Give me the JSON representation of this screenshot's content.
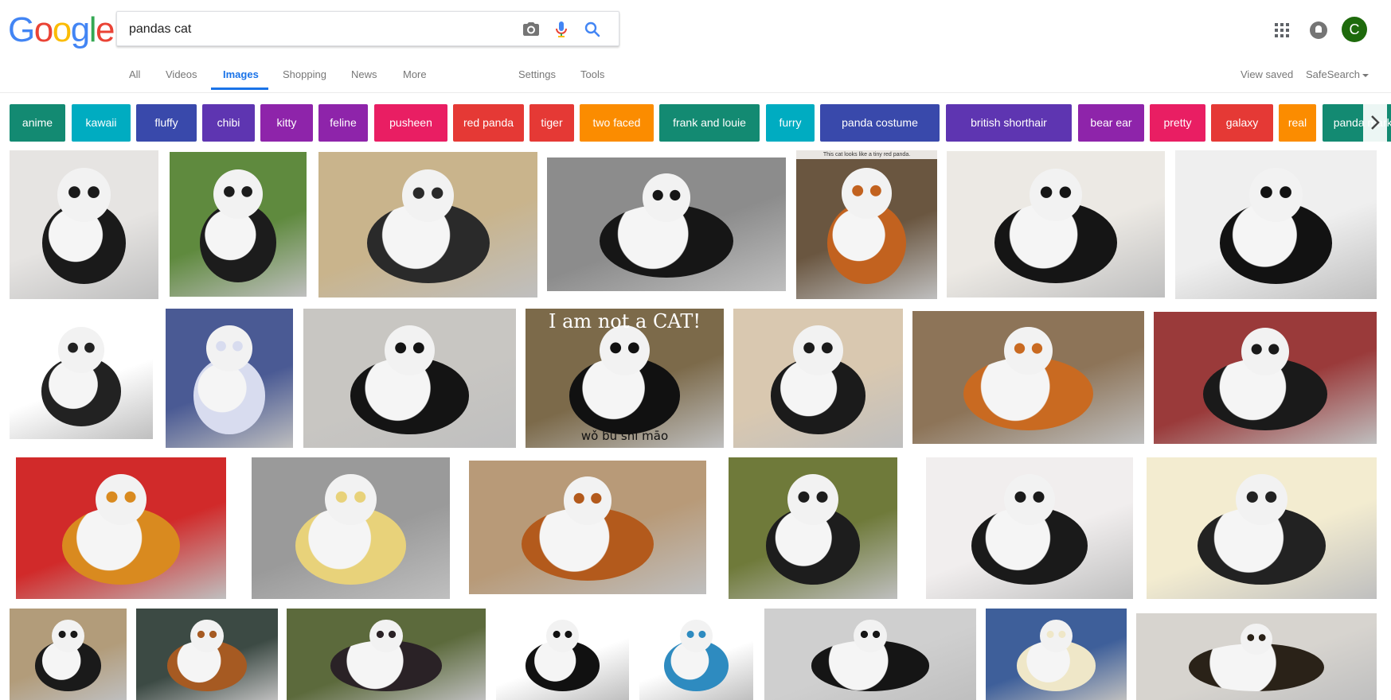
{
  "logo": {
    "letters": [
      {
        "ch": "G",
        "color": "#4285F4"
      },
      {
        "ch": "o",
        "color": "#EA4335"
      },
      {
        "ch": "o",
        "color": "#FBBC05"
      },
      {
        "ch": "g",
        "color": "#4285F4"
      },
      {
        "ch": "l",
        "color": "#34A853"
      },
      {
        "ch": "e",
        "color": "#EA4335"
      }
    ]
  },
  "search": {
    "value": "pandas cat",
    "icons": [
      "camera-icon",
      "microphone-icon",
      "search-icon"
    ]
  },
  "header": {
    "avatar_letter": "C",
    "icons": [
      "apps-grid-icon",
      "notifications-icon"
    ]
  },
  "nav": {
    "tabs": [
      {
        "label": "All",
        "active": false
      },
      {
        "label": "Videos",
        "active": false
      },
      {
        "label": "Images",
        "active": true
      },
      {
        "label": "Shopping",
        "active": false
      },
      {
        "label": "News",
        "active": false
      },
      {
        "label": "More",
        "active": false
      }
    ],
    "settings": "Settings",
    "tools": "Tools",
    "view_saved": "View saved",
    "safesearch": "SafeSearch"
  },
  "chips": [
    {
      "label": "anime",
      "color": "#138a72"
    },
    {
      "label": "kawaii",
      "color": "#00acc1"
    },
    {
      "label": "fluffy",
      "color": "#3949ab"
    },
    {
      "label": "chibi",
      "color": "#5e35b1"
    },
    {
      "label": "kitty",
      "color": "#8e24aa"
    },
    {
      "label": "feline",
      "color": "#8e24aa"
    },
    {
      "label": "pusheen",
      "color": "#e91e63"
    },
    {
      "label": "red panda",
      "color": "#e53935"
    },
    {
      "label": "tiger",
      "color": "#e53935"
    },
    {
      "label": "two faced",
      "color": "#fb8c00"
    },
    {
      "label": "frank and louie",
      "color": "#138a72"
    },
    {
      "label": "furry",
      "color": "#00acc1"
    },
    {
      "label": "panda costume",
      "color": "#3949ab"
    },
    {
      "label": "british shorthair",
      "color": "#5e35b1"
    },
    {
      "label": "bear ear",
      "color": "#8e24aa"
    },
    {
      "label": "pretty",
      "color": "#e91e63"
    },
    {
      "label": "galaxy",
      "color": "#e53935"
    },
    {
      "label": "real",
      "color": "#fb8c00"
    },
    {
      "label": "panda marking",
      "color": "#138a72"
    }
  ],
  "images": [
    {
      "caption": "",
      "bg": "#e6e4e2",
      "ink": "#1a1a1a"
    },
    {
      "caption": "",
      "bg": "#5f8a3e",
      "ink": "#1c1c1c"
    },
    {
      "caption": "",
      "bg": "#c9b48c",
      "ink": "#2a2a2a"
    },
    {
      "caption": "",
      "bg": "#8c8c8c",
      "ink": "#161616"
    },
    {
      "caption": "This cat looks like a tiny red panda.",
      "bg": "#6a5640",
      "ink": "#c2621f"
    },
    {
      "caption": "",
      "bg": "#ece9e4",
      "ink": "#151515"
    },
    {
      "caption": "",
      "bg": "#efefef",
      "ink": "#121212"
    },
    {
      "caption": "",
      "bg": "#ffffff",
      "ink": "#222222"
    },
    {
      "caption": "",
      "bg": "#4a5a94",
      "ink": "#d8dcef"
    },
    {
      "caption": "",
      "bg": "#c8c6c2",
      "ink": "#141414"
    },
    {
      "caption": "I am not a CAT!",
      "bg": "#7c6a4a",
      "ink": "#111111",
      "sub": "wǒ bú shì māo"
    },
    {
      "caption": "",
      "bg": "#d9c8b0",
      "ink": "#1b1b1b"
    },
    {
      "caption": "",
      "bg": "#8d7458",
      "ink": "#c96a21"
    },
    {
      "caption": "",
      "bg": "#9a3a3a",
      "ink": "#1a1a1a"
    },
    {
      "caption": "",
      "bg": "#d12a2a",
      "ink": "#d98a1f"
    },
    {
      "caption": "",
      "bg": "#9a9a9a",
      "ink": "#e8d27a"
    },
    {
      "caption": "",
      "bg": "#b89a78",
      "ink": "#b35a1c"
    },
    {
      "caption": "",
      "bg": "#6f7a3a",
      "ink": "#1d1d1d"
    },
    {
      "caption": "",
      "bg": "#f1eeee",
      "ink": "#1a1a1a"
    },
    {
      "caption": "",
      "bg": "#f3ecd0",
      "ink": "#222222"
    },
    {
      "caption": "",
      "bg": "#b29c7a",
      "ink": "#1a1a1a"
    },
    {
      "caption": "",
      "bg": "#3c4a44",
      "ink": "#a65a22"
    },
    {
      "caption": "",
      "bg": "#5c6a3c",
      "ink": "#2a2226"
    },
    {
      "caption": "",
      "bg": "#ffffff",
      "ink": "#111111"
    },
    {
      "caption": "",
      "bg": "#ffffff",
      "ink": "#2e8bc0"
    },
    {
      "caption": "",
      "bg": "#cfcfcf",
      "ink": "#151515"
    },
    {
      "caption": "",
      "bg": "#3e5f9a",
      "ink": "#efe7c8"
    },
    {
      "caption": "",
      "bg": "#d7d4cf",
      "ink": "#2a2218"
    }
  ]
}
